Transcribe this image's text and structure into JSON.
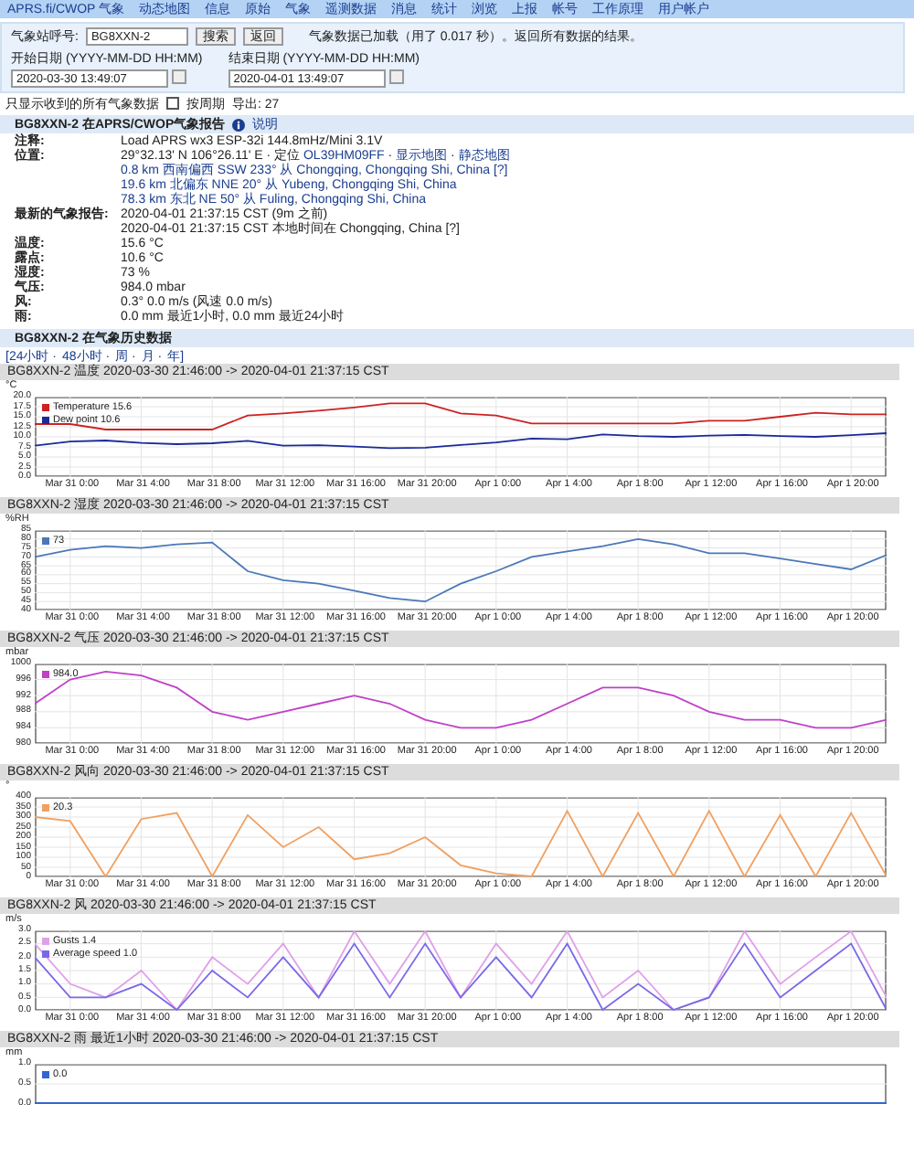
{
  "nav": [
    "APRS.fi/CWOP 气象",
    "动态地图",
    "信息",
    "原始",
    "气象",
    "遥测数据",
    "消息",
    "统计",
    "浏览",
    "上报",
    "帐号",
    "工作原理",
    "用户帐户"
  ],
  "search": {
    "label": "气象站呼号:",
    "value": "BG8XXN-2",
    "buttons": [
      "搜索",
      "返回"
    ],
    "note": "气象数据已加载（用了 0.017 秒）。返回所有数据的结果。",
    "start_label": "开始日期 (YYYY-MM-DD HH:MM)",
    "start_value": "2020-03-30 13:49:07",
    "end_label": "结束日期 (YYYY-MM-DD HH:MM)",
    "end_value": "2020-04-01 13:49:07"
  },
  "options": {
    "text": "只显示收到的所有气象数据",
    "checkbox_label": "按周期",
    "checked": false,
    "extra": "导出: 27"
  },
  "info": {
    "title": "BG8XXN-2 在APRS/CWOP气象报告",
    "help": "说明",
    "rows": [
      {
        "label": "注释:",
        "lines": [
          [
            {
              "text": "Load APRS wx3 ESP-32i 144.8mHz/Mini 3.1V"
            }
          ]
        ]
      },
      {
        "label": "位置:",
        "lines": [
          [
            {
              "text": "29°32.13' N 106°26.11' E · 定位 "
            },
            {
              "text": "OL39HM09FF",
              "link": true
            },
            {
              "text": " · "
            },
            {
              "text": "显示地图",
              "link": true
            },
            {
              "text": " · "
            },
            {
              "text": "静态地图",
              "link": true
            }
          ],
          [
            {
              "text": "0.8 km 西南偏西 SSW 233° 从 Chongqing, Chongqing Shi, China [?]",
              "link": true
            }
          ],
          [
            {
              "text": "19.6 km 北偏东 NNE 20° 从 Yubeng, Chongqing Shi, China",
              "link": true
            }
          ],
          [
            {
              "text": "78.3 km 东北 NE 50° 从 Fuling, Chongqing Shi, China",
              "link": true
            }
          ]
        ]
      },
      {
        "label": "最新的气象报告:",
        "lines": [
          [
            {
              "text": "2020-04-01 21:37:15 CST (9m 之前)"
            }
          ],
          [
            {
              "text": "2020-04-01 21:37:15 CST 本地时间在 Chongqing, China [?]"
            }
          ]
        ]
      },
      {
        "label": "温度:",
        "lines": [
          [
            {
              "text": "15.6 °C"
            }
          ]
        ]
      },
      {
        "label": "露点:",
        "lines": [
          [
            {
              "text": "10.6 °C"
            }
          ]
        ]
      },
      {
        "label": "湿度:",
        "lines": [
          [
            {
              "text": "73 %"
            }
          ]
        ]
      },
      {
        "label": "气压:",
        "lines": [
          [
            {
              "text": "984.0 mbar"
            }
          ]
        ]
      },
      {
        "label": "风:",
        "lines": [
          [
            {
              "text": "0.3° 0.0 m/s (风速 0.0 m/s)"
            }
          ]
        ]
      },
      {
        "label": "雨:",
        "lines": [
          [
            {
              "text": "0.0 mm 最近1小时, 0.0 mm 最近24小时"
            }
          ]
        ]
      }
    ]
  },
  "history": {
    "title": "BG8XXN-2 在气象历史数据",
    "periods": [
      "[24小时 ·",
      "48小时 ·",
      "周 ·",
      "月 ·",
      "年]"
    ]
  },
  "charts": [
    {
      "title": "BG8XXN-2 温度 2020-03-30 21:46:00 -> 2020-04-01 21:37:15 CST",
      "chart_data": {
        "type": "line",
        "grid": true,
        "legend": "upper left",
        "ylabel": "°C",
        "categories": [
          null,
          "Mar 31 0:00",
          null,
          "Mar 31 4:00",
          null,
          "Mar 31 8:00",
          null,
          "Mar 31 12:00",
          null,
          "Mar 31 16:00",
          null,
          "Mar 31 20:00",
          null,
          "Apr 1 0:00",
          null,
          "Apr 1 4:00",
          null,
          "Apr 1 8:00",
          null,
          "Apr 1 12:00",
          null,
          "Apr 1 16:00",
          null,
          "Apr 1 20:00",
          null
        ],
        "ylim": [
          0,
          20
        ],
        "yticks": [
          {
            "value": 0,
            "label": "0.0"
          },
          {
            "value": 2.5,
            "label": "2.5"
          },
          {
            "value": 5,
            "label": "5.0"
          },
          {
            "value": 7.5,
            "label": "7.5"
          },
          {
            "value": 10,
            "label": "10.0"
          },
          {
            "value": 12.5,
            "label": "12.5"
          },
          {
            "value": 15,
            "label": "15.0"
          },
          {
            "value": 17.5,
            "label": "17.5"
          },
          {
            "value": 20,
            "label": "20.0"
          }
        ],
        "series": [
          {
            "name": "Temperature 15.6",
            "color": "#cc2222",
            "values": [
              13.2,
              13.2,
              11.8,
              11.8,
              11.8,
              11.8,
              15.3,
              15.8,
              16.5,
              17.3,
              18.3,
              18.3,
              15.8,
              15.3,
              13.3,
              13.3,
              13.3,
              13.3,
              13.3,
              14.0,
              14.0,
              15.0,
              16.0,
              15.6,
              15.6
            ]
          },
          {
            "name": "Dew point 10.6",
            "color": "#1a2a99",
            "values": [
              7.8,
              8.8,
              9.1,
              8.5,
              8.2,
              8.4,
              9.0,
              7.8,
              7.9,
              7.6,
              7.2,
              7.3,
              8.0,
              8.6,
              9.6,
              9.4,
              10.6,
              10.2,
              10.0,
              10.3,
              10.5,
              10.2,
              10.0,
              10.4,
              10.9
            ]
          }
        ]
      }
    },
    {
      "title": "BG8XXN-2 湿度 2020-03-30 21:46:00 -> 2020-04-01 21:37:15 CST",
      "chart_data": {
        "type": "line",
        "grid": true,
        "legend": "upper left",
        "ylabel": "%RH",
        "categories": [
          null,
          "Mar 31 0:00",
          null,
          "Mar 31 4:00",
          null,
          "Mar 31 8:00",
          null,
          "Mar 31 12:00",
          null,
          "Mar 31 16:00",
          null,
          "Mar 31 20:00",
          null,
          "Apr 1 0:00",
          null,
          "Apr 1 4:00",
          null,
          "Apr 1 8:00",
          null,
          "Apr 1 12:00",
          null,
          "Apr 1 16:00",
          null,
          "Apr 1 20:00",
          null
        ],
        "ylim": [
          40,
          85
        ],
        "yticks": [
          {
            "value": 40,
            "label": "40"
          },
          {
            "value": 45,
            "label": "45"
          },
          {
            "value": 50,
            "label": "50"
          },
          {
            "value": 55,
            "label": "55"
          },
          {
            "value": 60,
            "label": "60"
          },
          {
            "value": 65,
            "label": "65"
          },
          {
            "value": 70,
            "label": "70"
          },
          {
            "value": 75,
            "label": "75"
          },
          {
            "value": 80,
            "label": "80"
          },
          {
            "value": 85,
            "label": "85"
          }
        ],
        "series": [
          {
            "name": "73",
            "color": "#4a78b8",
            "values": [
              70,
              74,
              76,
              75,
              77,
              78,
              62,
              57,
              55,
              51,
              47,
              45,
              55,
              62,
              70,
              73,
              76,
              80,
              77,
              72,
              72,
              69,
              66,
              63,
              71
            ]
          }
        ]
      }
    },
    {
      "title": "BG8XXN-2 气压 2020-03-30 21:46:00 -> 2020-04-01 21:37:15 CST",
      "chart_data": {
        "type": "line",
        "grid": true,
        "legend": "upper left",
        "ylabel": "mbar",
        "categories": [
          null,
          "Mar 31 0:00",
          null,
          "Mar 31 4:00",
          null,
          "Mar 31 8:00",
          null,
          "Mar 31 12:00",
          null,
          "Mar 31 16:00",
          null,
          "Mar 31 20:00",
          null,
          "Apr 1 0:00",
          null,
          "Apr 1 4:00",
          null,
          "Apr 1 8:00",
          null,
          "Apr 1 12:00",
          null,
          "Apr 1 16:00",
          null,
          "Apr 1 20:00",
          null
        ],
        "ylim": [
          980,
          1000
        ],
        "yticks": [
          {
            "value": 980,
            "label": "980"
          },
          {
            "value": 984,
            "label": "984"
          },
          {
            "value": 988,
            "label": "988"
          },
          {
            "value": 992,
            "label": "992"
          },
          {
            "value": 996,
            "label": "996"
          },
          {
            "value": 1000,
            "label": "1000"
          }
        ],
        "series": [
          {
            "name": "984.0",
            "color": "#c040c8",
            "values": [
              990,
              996,
              998,
              997,
              994,
              988,
              986,
              988,
              990,
              992,
              990,
              986,
              984,
              984,
              986,
              990,
              994,
              994,
              992,
              988,
              986,
              986,
              984,
              984,
              986
            ]
          }
        ]
      }
    },
    {
      "title": "BG8XXN-2 风向 2020-03-30 21:46:00 -> 2020-04-01 21:37:15 CST",
      "chart_data": {
        "type": "line",
        "grid": true,
        "legend": "upper left",
        "ylabel": "°",
        "categories": [
          null,
          "Mar 31 0:00",
          null,
          "Mar 31 4:00",
          null,
          "Mar 31 8:00",
          null,
          "Mar 31 12:00",
          null,
          "Mar 31 16:00",
          null,
          "Mar 31 20:00",
          null,
          "Apr 1 0:00",
          null,
          "Apr 1 4:00",
          null,
          "Apr 1 8:00",
          null,
          "Apr 1 12:00",
          null,
          "Apr 1 16:00",
          null,
          "Apr 1 20:00",
          null
        ],
        "ylim": [
          0,
          400
        ],
        "yticks": [
          {
            "value": 0,
            "label": "0"
          },
          {
            "value": 50,
            "label": "50"
          },
          {
            "value": 100,
            "label": "100"
          },
          {
            "value": 150,
            "label": "150"
          },
          {
            "value": 200,
            "label": "200"
          },
          {
            "value": 250,
            "label": "250"
          },
          {
            "value": 300,
            "label": "300"
          },
          {
            "value": 350,
            "label": "350"
          },
          {
            "value": 400,
            "label": "400"
          }
        ],
        "series": [
          {
            "name": "20.3",
            "color": "#f0a060",
            "values": [
              300,
              280,
              0,
              290,
              320,
              0,
              310,
              150,
              250,
              90,
              120,
              200,
              60,
              20,
              0,
              330,
              0,
              320,
              0,
              330,
              0,
              310,
              0,
              320,
              0
            ]
          }
        ]
      }
    },
    {
      "title": "BG8XXN-2 风 2020-03-30 21:46:00 -> 2020-04-01 21:37:15 CST",
      "chart_data": {
        "type": "line",
        "grid": true,
        "legend": "upper left",
        "ylabel": "m/s",
        "categories": [
          null,
          "Mar 31 0:00",
          null,
          "Mar 31 4:00",
          null,
          "Mar 31 8:00",
          null,
          "Mar 31 12:00",
          null,
          "Mar 31 16:00",
          null,
          "Mar 31 20:00",
          null,
          "Apr 1 0:00",
          null,
          "Apr 1 4:00",
          null,
          "Apr 1 8:00",
          null,
          "Apr 1 12:00",
          null,
          "Apr 1 16:00",
          null,
          "Apr 1 20:00",
          null
        ],
        "ylim": [
          0,
          3
        ],
        "yticks": [
          {
            "value": 0,
            "label": "0.0"
          },
          {
            "value": 0.5,
            "label": "0.5"
          },
          {
            "value": 1,
            "label": "1.0"
          },
          {
            "value": 1.5,
            "label": "1.5"
          },
          {
            "value": 2,
            "label": "2.0"
          },
          {
            "value": 2.5,
            "label": "2.5"
          },
          {
            "value": 3,
            "label": "3.0"
          }
        ],
        "series": [
          {
            "name": "Gusts 1.4",
            "color": "#e0a0e8",
            "values": [
              2.5,
              1.0,
              0.5,
              1.5,
              0.0,
              2.0,
              1.0,
              2.5,
              0.5,
              3.0,
              1.0,
              3.0,
              0.5,
              2.5,
              1.0,
              3.0,
              0.5,
              1.5,
              0.0,
              0.5,
              3.0,
              1.0,
              2.0,
              3.0,
              0.5
            ]
          },
          {
            "name": "Average speed 1.0",
            "color": "#7a68e8",
            "values": [
              2.0,
              0.5,
              0.5,
              1.0,
              0.0,
              1.5,
              0.5,
              2.0,
              0.5,
              2.5,
              0.5,
              2.5,
              0.5,
              2.0,
              0.5,
              2.5,
              0.0,
              1.0,
              0.0,
              0.5,
              2.5,
              0.5,
              1.5,
              2.5,
              0.0
            ]
          }
        ]
      }
    },
    {
      "title": "BG8XXN-2 雨 最近1小时 2020-03-30 21:46:00 -> 2020-04-01 21:37:15 CST",
      "chart_data": {
        "type": "line",
        "grid": true,
        "legend": "upper left",
        "ylabel": "mm",
        "ylim": [
          0,
          1
        ],
        "yticks": [
          {
            "value": 0,
            "label": "0.0"
          },
          {
            "value": 0.5,
            "label": "0.5"
          },
          {
            "value": 1,
            "label": "1.0"
          }
        ],
        "series": [
          {
            "name": "0.0",
            "color": "#3366cc",
            "values": [
              0,
              0,
              0,
              0,
              0,
              0,
              0,
              0,
              0,
              0,
              0,
              0,
              0,
              0,
              0,
              0,
              0,
              0,
              0,
              0,
              0,
              0,
              0,
              0,
              0
            ]
          }
        ]
      }
    }
  ]
}
